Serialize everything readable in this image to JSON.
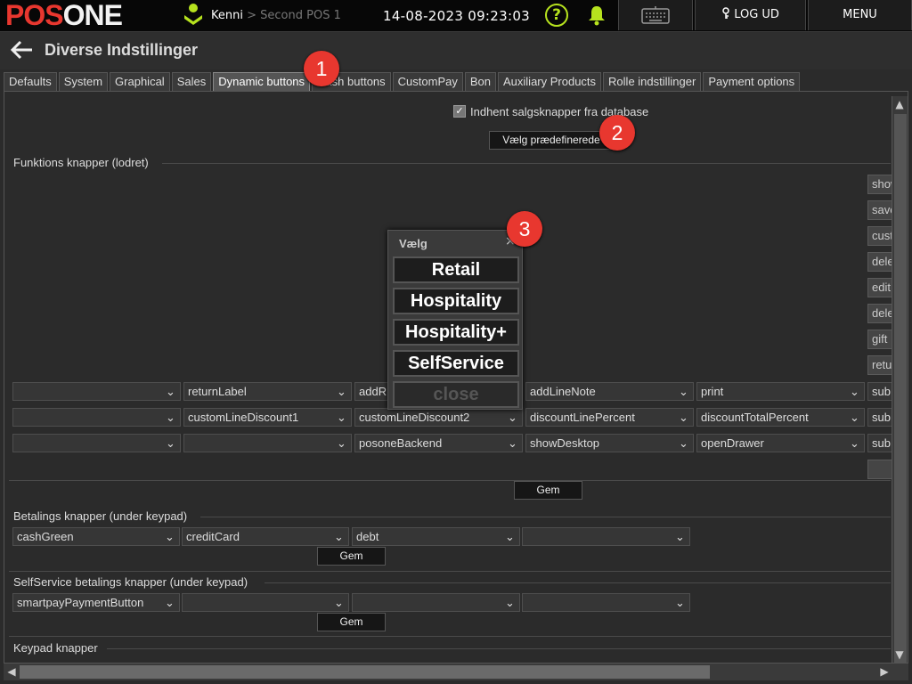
{
  "header": {
    "logo_pos": "POS",
    "logo_one": "ONE",
    "user_name": "Kenni",
    "user_sep": ">",
    "pos_name": "Second POS 1",
    "clock": "14-08-2023 09:23:03",
    "help_label": "?",
    "logout_label": "LOG UD",
    "menu_label": "MENU"
  },
  "page": {
    "back_icon": "arrow-left-icon",
    "title": "Diverse Indstillinger"
  },
  "tabs": [
    "Defaults",
    "System",
    "Graphical",
    "Sales",
    "Dynamic buttons",
    "Cash buttons",
    "CustomPay",
    "Bon",
    "Auxiliary Products",
    "Rolle indstillinger",
    "Payment options"
  ],
  "active_tab": "Dynamic buttons",
  "dynamic": {
    "fetch_checkbox_label": "Indhent salgsknapper fra database",
    "fetch_checked": true,
    "choose_predefined": "Vælg prædefinerede",
    "function_section": "Funktions knapper (lodret)",
    "side_buttons": [
      "show",
      "save",
      "cust",
      "dele",
      "edit",
      "dele",
      "gift",
      "retu"
    ],
    "rows": [
      [
        "",
        "returnLabel",
        "addR",
        "addLineNote",
        "print",
        "sub"
      ],
      [
        "",
        "customLineDiscount1",
        "customLineDiscount2",
        "discountLinePercent",
        "discountTotalPercent",
        "sub"
      ],
      [
        "",
        "",
        "posoneBackend",
        "showDesktop",
        "openDrawer",
        "sub"
      ]
    ],
    "save_label": "Gem"
  },
  "payment": {
    "section": "Betalings knapper (under keypad)",
    "values": [
      "cashGreen",
      "creditCard",
      "debt",
      ""
    ],
    "save_label": "Gem"
  },
  "selfservice": {
    "section": "SelfService betalings knapper (under keypad)",
    "values": [
      "smartpayPaymentButton",
      "",
      "",
      ""
    ],
    "save_label": "Gem"
  },
  "keypad": {
    "section": "Keypad knapper"
  },
  "dialog": {
    "title": "Vælg",
    "close_x": "×",
    "options": [
      "Retail",
      "Hospitality",
      "Hospitality+",
      "SelfService"
    ],
    "close_label": "close"
  },
  "badges": [
    "1",
    "2",
    "3"
  ],
  "colors": {
    "brand_red": "#e8372f",
    "accent_green": "#b6e21e",
    "bg": "#2b2b2b",
    "topbar": "#070707"
  }
}
